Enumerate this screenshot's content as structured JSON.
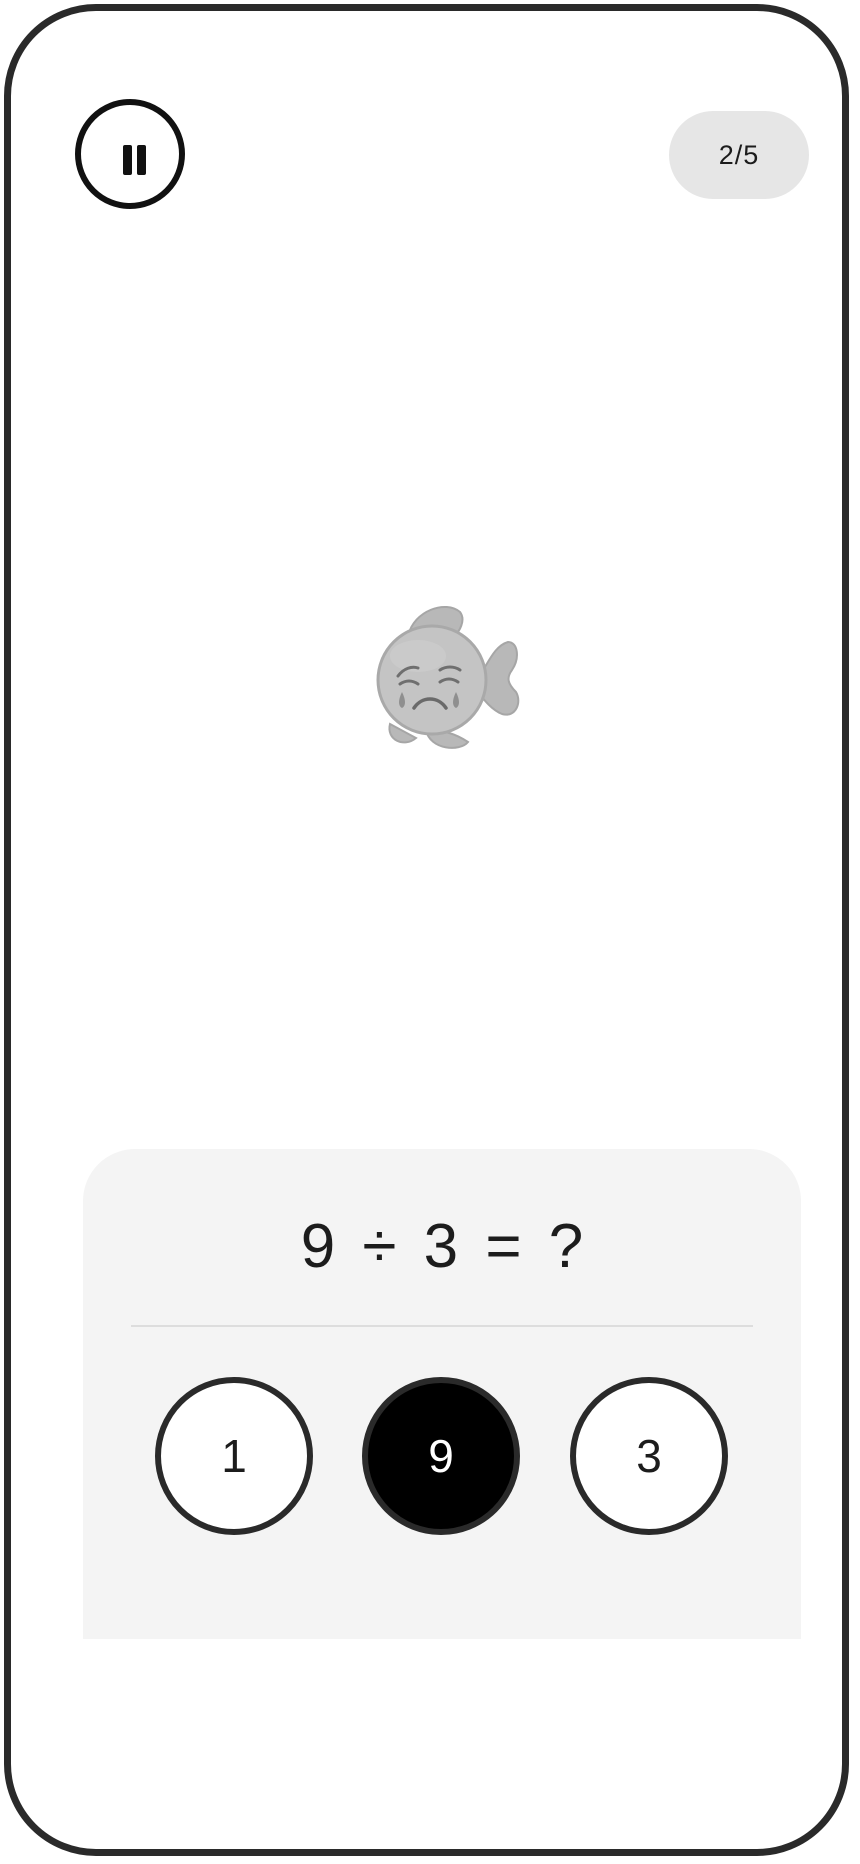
{
  "header": {
    "pause_icon": "pause-icon",
    "progress": "2/5",
    "progress_current": 2,
    "progress_total": 5
  },
  "mascot": {
    "icon": "sad-fish-icon"
  },
  "quiz": {
    "question": "9 ÷ 3 = ?",
    "answers": [
      {
        "label": "1",
        "selected": false
      },
      {
        "label": "9",
        "selected": true
      },
      {
        "label": "3",
        "selected": false
      }
    ]
  },
  "colors": {
    "frame": "#2a2a2a",
    "card_background": "#f4f4f4",
    "pill_background": "#e6e6e6",
    "selected_answer": "#000000",
    "fish": "#bfbfbf"
  }
}
